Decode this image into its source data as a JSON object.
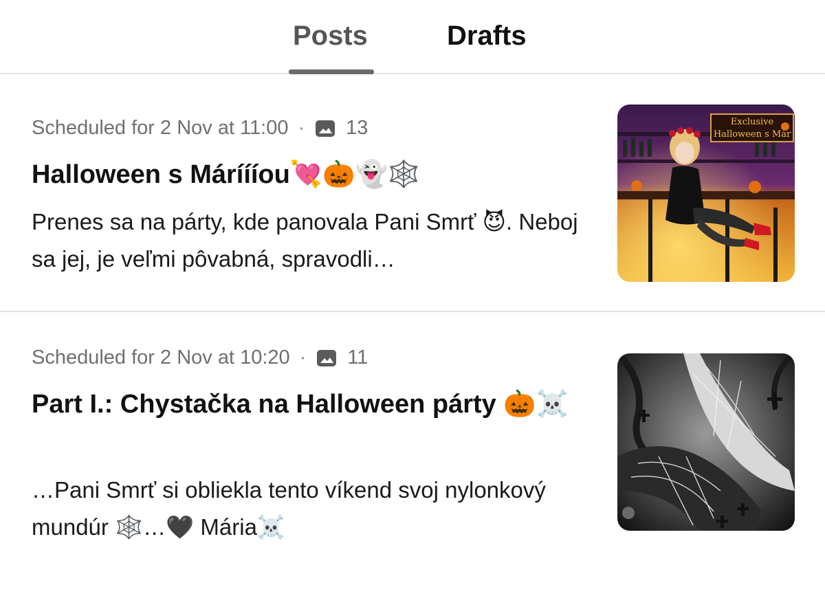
{
  "tabs": {
    "posts_label": "Posts",
    "drafts_label": "Drafts",
    "active": "Posts"
  },
  "posts": [
    {
      "scheduled": "Scheduled for 2 Nov at 11:00",
      "separator": "·",
      "image_icon": "image-icon",
      "image_count": "13",
      "title": "Halloween s Máríííou💘🎃👻🕸️",
      "excerpt": "Prenes sa na párty, kde panovala Pani Smrť 😈. Neboj sa jej, je veľmi pôvabná, spravodli…",
      "thumbnail": {
        "badge_line1": "Exclusive",
        "badge_line2": "Halloween s Már"
      }
    },
    {
      "scheduled": "Scheduled for 2 Nov at 10:20",
      "separator": "·",
      "image_icon": "image-icon",
      "image_count": "11",
      "title": "Part I.: Chystačka na Halloween párty 🎃☠️",
      "excerpt": "…Pani Smrť si obliekla tento víkend svoj nylonkový mundúr 🕸️…🖤 Mária☠️"
    }
  ],
  "colors": {
    "active_tab": "#555555",
    "inactive_tab": "#111111",
    "meta_text": "#6f6f6f",
    "divider": "#e2e2e2"
  }
}
